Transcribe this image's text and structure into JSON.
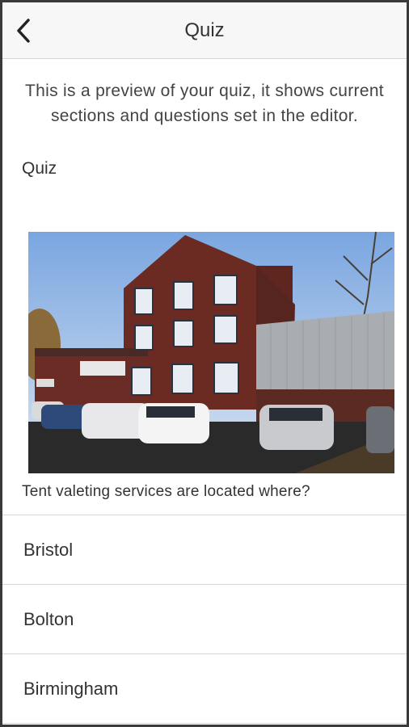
{
  "header": {
    "title": "Quiz",
    "back_icon": "chevron-left-icon"
  },
  "intro_text": "This is a preview of your quiz, it shows current sections and questions set in the editor.",
  "section": {
    "title": "Quiz"
  },
  "question": {
    "text": "Tent valeting services are located where?",
    "answers": [
      "Bristol",
      "Bolton",
      "Birmingham"
    ]
  },
  "colors": {
    "header_bg": "#f7f7f7",
    "divider": "#d6d6d6",
    "text": "#333333"
  }
}
